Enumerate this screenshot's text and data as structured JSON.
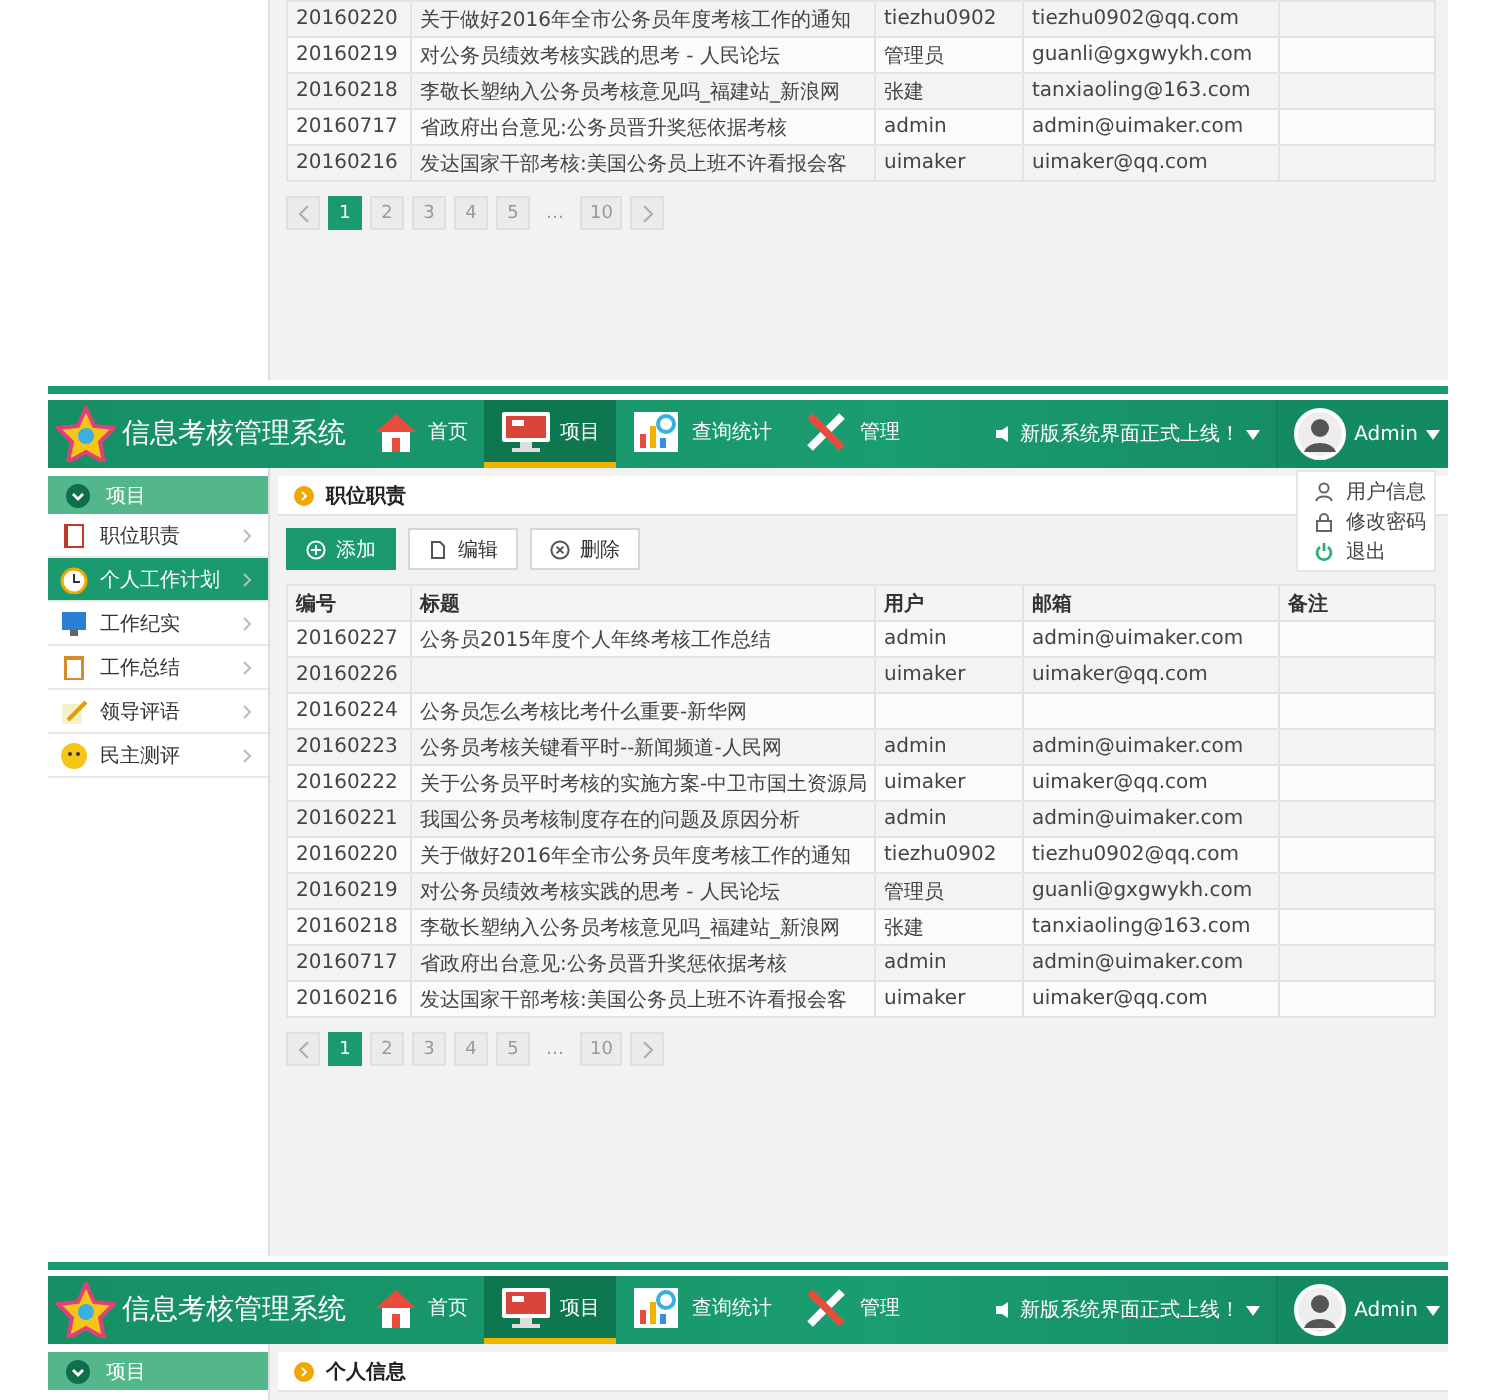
{
  "screens": [
    {
      "kind": "tail",
      "table": {
        "rows": [
          {
            "id": "20160220",
            "title": "关于做好2016年全市公务员年度考核工作的通知",
            "user": "tiezhu0902",
            "email": "tiezhu0902@qq.com"
          },
          {
            "id": "20160219",
            "title": "对公务员绩效考核实践的思考 - 人民论坛",
            "user": "管理员",
            "email": "guanli@gxgwykh.com"
          },
          {
            "id": "20160218",
            "title": "李敬长塑纳入公务员考核意见吗_福建站_新浪网",
            "user": "张建",
            "email": "tanxiaoling@163.com"
          },
          {
            "id": "20160717",
            "title": "省政府出台意见:公务员晋升奖惩依据考核",
            "user": "admin",
            "email": "admin@uimaker.com"
          },
          {
            "id": "20160216",
            "title": "发达国家干部考核:美国公务员上班不许看报会客",
            "user": "uimaker",
            "email": "uimaker@qq.com"
          }
        ]
      },
      "pagination": [
        {
          "label": "1",
          "selected": true
        },
        {
          "label": "2",
          "selected": false
        },
        {
          "label": "3",
          "selected": false
        },
        {
          "label": "4",
          "selected": false
        },
        {
          "label": "5",
          "selected": false
        },
        {
          "label": "…",
          "selected": false
        },
        {
          "label": "10",
          "selected": false
        }
      ]
    },
    {
      "kind": "full",
      "header": {
        "title": "信息考核管理系统",
        "nav": [
          {
            "label": "首页",
            "selected": false
          },
          {
            "label": "项目",
            "selected": true
          },
          {
            "label": "查询统计",
            "selected": false
          },
          {
            "label": "管理",
            "selected": false
          }
        ],
        "notice": "新版系统界面正式上线！",
        "user": "Admin"
      },
      "sidebar": {
        "heading": "项目",
        "items": [
          {
            "label": "职位职责",
            "selected": false
          },
          {
            "label": "个人工作计划",
            "selected": true
          },
          {
            "label": "工作纪实",
            "selected": false
          },
          {
            "label": "工作总结",
            "selected": false
          },
          {
            "label": "领导评语",
            "selected": false
          },
          {
            "label": "民主测评",
            "selected": false
          }
        ]
      },
      "breadcrumb": "职位职责",
      "toolbar": [
        {
          "label": "添加",
          "kind": "primary"
        },
        {
          "label": "编辑",
          "kind": "edit"
        },
        {
          "label": "删除",
          "kind": "delete"
        }
      ],
      "user_menu": [
        "用户信息",
        "修改密码",
        "退出"
      ],
      "table": {
        "columns": [
          "编号",
          "标题",
          "用户",
          "邮箱",
          "备注"
        ],
        "rows": [
          {
            "id": "20160227",
            "title": "公务员2015年度个人年终考核工作总结",
            "user": "admin",
            "email": "admin@uimaker.com"
          },
          {
            "id": "20160226",
            "user": "uimaker",
            "email": "uimaker@qq.com"
          },
          {
            "id": "20160224",
            "title": "公务员怎么考核比考什么重要-新华网"
          },
          {
            "id": "20160223",
            "title": "公务员考核关键看平时--新闻频道-人民网",
            "user": "admin",
            "email": "admin@uimaker.com"
          },
          {
            "id": "20160222",
            "title": "关于公务员平时考核的实施方案-中卫市国土资源局",
            "user": "uimaker",
            "email": "uimaker@qq.com"
          },
          {
            "id": "20160221",
            "title": "我国公务员考核制度存在的问题及原因分析",
            "user": "admin",
            "email": "admin@uimaker.com"
          },
          {
            "id": "20160220",
            "title": "关于做好2016年全市公务员年度考核工作的通知",
            "user": "tiezhu0902",
            "email": "tiezhu0902@qq.com"
          },
          {
            "id": "20160219",
            "title": "对公务员绩效考核实践的思考 - 人民论坛",
            "user": "管理员",
            "email": "guanli@gxgwykh.com"
          },
          {
            "id": "20160218",
            "title": "李敬长塑纳入公务员考核意见吗_福建站_新浪网",
            "user": "张建",
            "email": "tanxiaoling@163.com"
          },
          {
            "id": "20160717",
            "title": "省政府出台意见:公务员晋升奖惩依据考核",
            "user": "admin",
            "email": "admin@uimaker.com"
          },
          {
            "id": "20160216",
            "title": "发达国家干部考核:美国公务员上班不许看报会客",
            "user": "uimaker",
            "email": "uimaker@qq.com"
          }
        ]
      },
      "pagination": [
        {
          "label": "1",
          "selected": true
        },
        {
          "label": "2",
          "selected": false
        },
        {
          "label": "3",
          "selected": false
        },
        {
          "label": "4",
          "selected": false
        },
        {
          "label": "5",
          "selected": false
        },
        {
          "label": "…",
          "selected": false
        },
        {
          "label": "10",
          "selected": false
        }
      ]
    },
    {
      "kind": "head",
      "header": {
        "title": "信息考核管理系统",
        "nav": [
          {
            "label": "首页",
            "selected": false
          },
          {
            "label": "项目",
            "selected": true
          },
          {
            "label": "查询统计",
            "selected": false
          },
          {
            "label": "管理",
            "selected": false
          }
        ],
        "notice": "新版系统界面正式上线！",
        "user": "Admin"
      },
      "sidebar": {
        "heading": "项目"
      },
      "breadcrumb": "个人信息"
    }
  ]
}
